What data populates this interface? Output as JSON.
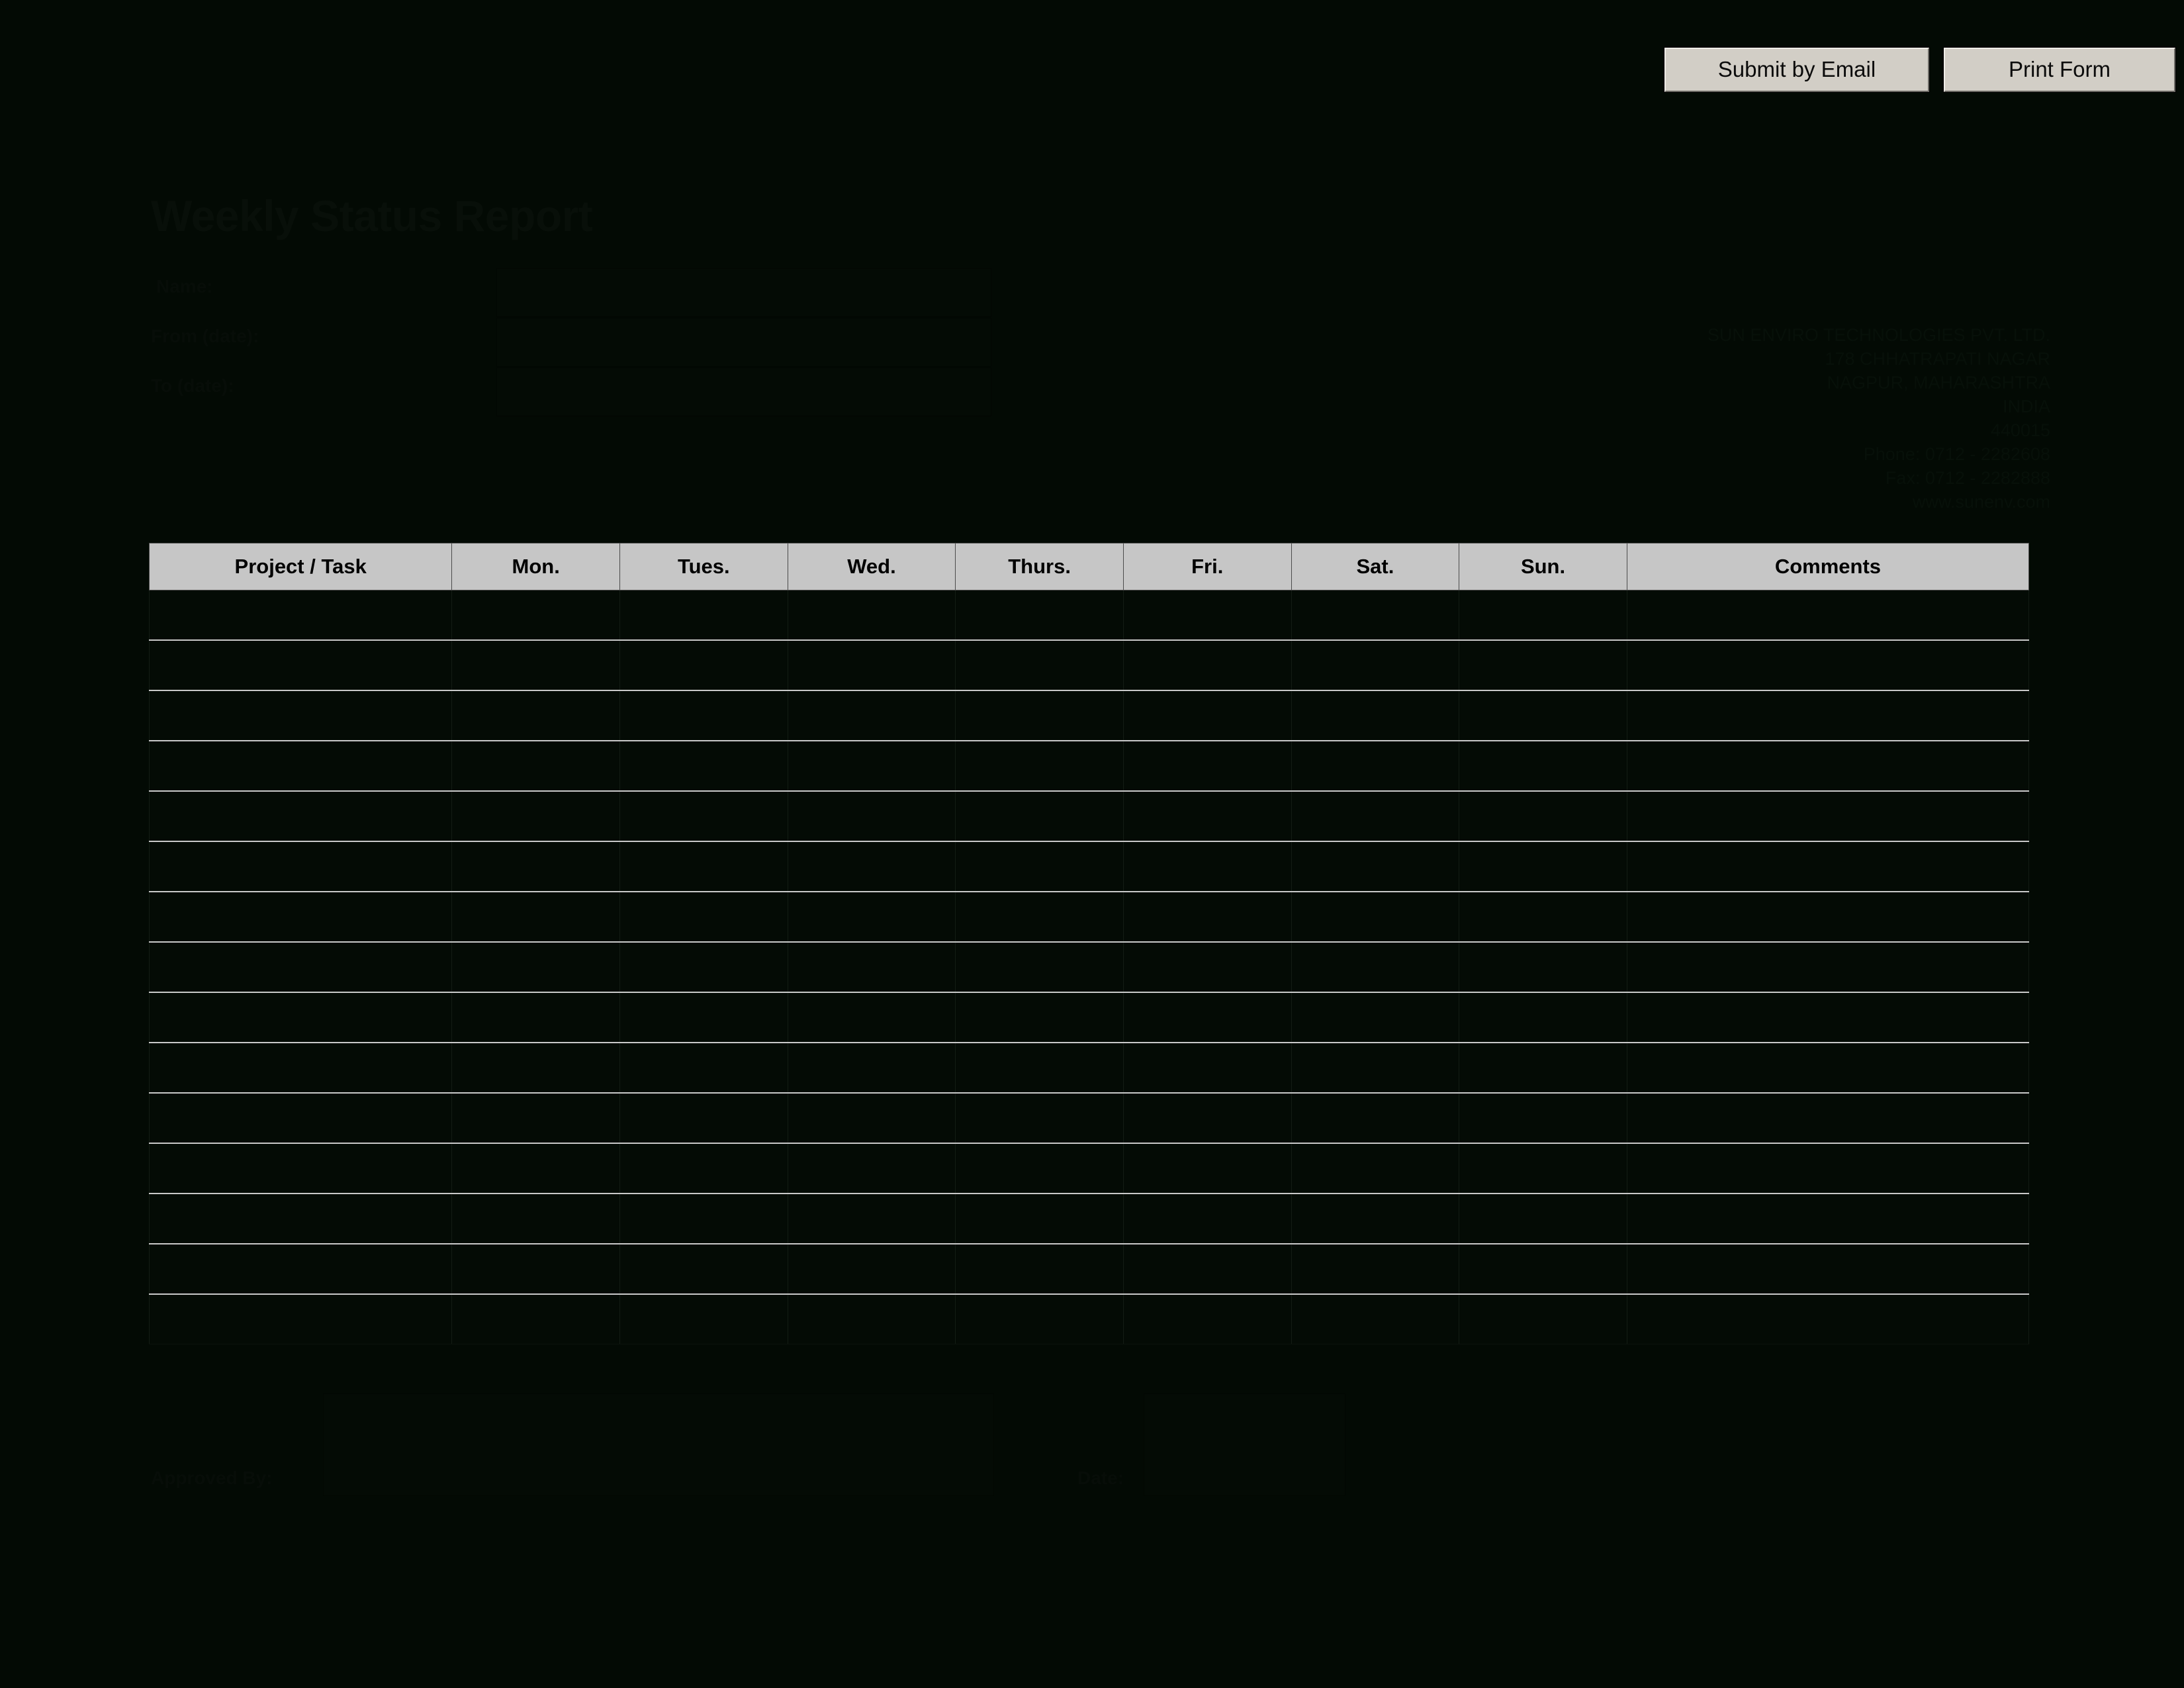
{
  "toolbar": {
    "submit_label": "Submit by Email",
    "print_label": "Print Form"
  },
  "document": {
    "title": "Weekly Status Report"
  },
  "identity": {
    "name_label": "Name:",
    "name_value": "",
    "from_label": "From (date):",
    "from_value": "",
    "to_label": "To (date):",
    "to_value": ""
  },
  "company": {
    "line1": "SUN ENVIRO TECHNOLOGIES PVT. LTD.",
    "line2": "178 CHHATRAPATI NAGAR",
    "line3": "NAGPUR, MAHARASHTRA",
    "line4": "INDIA",
    "line5": "440015",
    "line6": "Phone: 0712 - 2282608",
    "line7": "Fax: 0712 - 2282888",
    "line8": "www.sunenv.com"
  },
  "table": {
    "headers": [
      "Project / Task",
      "Mon.",
      "Tues.",
      "Wed.",
      "Thurs.",
      "Fri.",
      "Sat.",
      "Sun.",
      "Comments"
    ],
    "row_count": 15,
    "rows": [
      [
        "",
        "",
        "",
        "",
        "",
        "",
        "",
        "",
        ""
      ],
      [
        "",
        "",
        "",
        "",
        "",
        "",
        "",
        "",
        ""
      ],
      [
        "",
        "",
        "",
        "",
        "",
        "",
        "",
        "",
        ""
      ],
      [
        "",
        "",
        "",
        "",
        "",
        "",
        "",
        "",
        ""
      ],
      [
        "",
        "",
        "",
        "",
        "",
        "",
        "",
        "",
        ""
      ],
      [
        "",
        "",
        "",
        "",
        "",
        "",
        "",
        "",
        ""
      ],
      [
        "",
        "",
        "",
        "",
        "",
        "",
        "",
        "",
        ""
      ],
      [
        "",
        "",
        "",
        "",
        "",
        "",
        "",
        "",
        ""
      ],
      [
        "",
        "",
        "",
        "",
        "",
        "",
        "",
        "",
        ""
      ],
      [
        "",
        "",
        "",
        "",
        "",
        "",
        "",
        "",
        ""
      ],
      [
        "",
        "",
        "",
        "",
        "",
        "",
        "",
        "",
        ""
      ],
      [
        "",
        "",
        "",
        "",
        "",
        "",
        "",
        "",
        ""
      ],
      [
        "",
        "",
        "",
        "",
        "",
        "",
        "",
        "",
        ""
      ],
      [
        "",
        "",
        "",
        "",
        "",
        "",
        "",
        "",
        ""
      ],
      [
        "",
        "",
        "",
        "",
        "",
        "",
        "",
        "",
        ""
      ]
    ]
  },
  "approval": {
    "approved_by_label": "Approved By:",
    "approved_by_value": "",
    "date_label": "Date:",
    "date_value": ""
  },
  "colors": {
    "page_background": "#030a04",
    "header_fill": "#c6c6c6",
    "button_face": "#d2cec6",
    "grid_line": "#c9c9c9"
  }
}
